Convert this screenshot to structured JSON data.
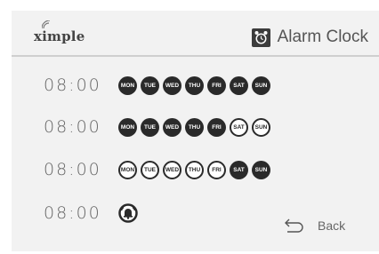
{
  "header": {
    "logo_text": "ximple",
    "title": "Alarm Clock"
  },
  "alarms": [
    {
      "time": "08:00",
      "days": [
        {
          "label": "MON",
          "active": true
        },
        {
          "label": "TUE",
          "active": true
        },
        {
          "label": "WED",
          "active": true
        },
        {
          "label": "THU",
          "active": true
        },
        {
          "label": "FRI",
          "active": true
        },
        {
          "label": "SAT",
          "active": true
        },
        {
          "label": "SUN",
          "active": true
        }
      ]
    },
    {
      "time": "08:00",
      "days": [
        {
          "label": "MON",
          "active": true
        },
        {
          "label": "TUE",
          "active": true
        },
        {
          "label": "WED",
          "active": true
        },
        {
          "label": "THU",
          "active": true
        },
        {
          "label": "FRI",
          "active": true
        },
        {
          "label": "SAT",
          "active": false
        },
        {
          "label": "SUN",
          "active": false
        }
      ]
    },
    {
      "time": "08:00",
      "days": [
        {
          "label": "MON",
          "active": false
        },
        {
          "label": "TUE",
          "active": false
        },
        {
          "label": "WED",
          "active": false
        },
        {
          "label": "THU",
          "active": false
        },
        {
          "label": "FRI",
          "active": false
        },
        {
          "label": "SAT",
          "active": true
        },
        {
          "label": "SUN",
          "active": true
        }
      ]
    },
    {
      "time": "08:00",
      "icon": "alarm-bell-icon"
    }
  ],
  "footer": {
    "back_label": "Back",
    "back_icon": "back-arrow-icon"
  },
  "colors": {
    "background": "#f2f2f2",
    "day_active": "#2a2a2a",
    "text": "#666666"
  }
}
